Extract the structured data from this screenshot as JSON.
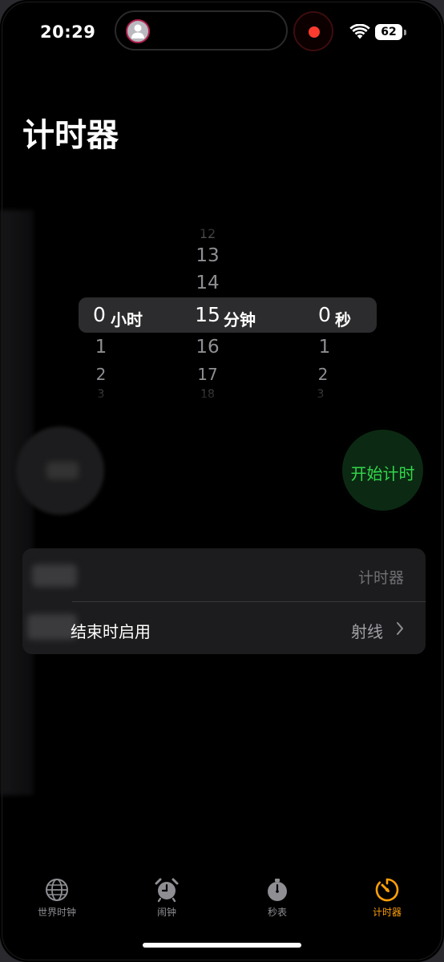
{
  "status_bar": {
    "time": "20:29",
    "battery": "62"
  },
  "page": {
    "title": "计时器"
  },
  "picker": {
    "hours": {
      "above": [
        "",
        ""
      ],
      "selected": "0",
      "unit": "小时",
      "below": [
        "1",
        "2",
        "3"
      ]
    },
    "minutes": {
      "above": [
        "12",
        "13",
        "14"
      ],
      "selected": "15",
      "unit": "分钟",
      "below": [
        "16",
        "17",
        "18"
      ]
    },
    "seconds": {
      "above": [
        "",
        ""
      ],
      "selected": "0",
      "unit": "秒",
      "below": [
        "1",
        "2",
        "3"
      ]
    }
  },
  "buttons": {
    "start": "开始计时"
  },
  "settings": {
    "label_row": {
      "value": "计时器"
    },
    "end_row": {
      "label": "结束时启用",
      "value": "射线"
    }
  },
  "tabbar": {
    "tabs": [
      {
        "label": "世界时钟",
        "icon": "globe-icon",
        "active": false
      },
      {
        "label": "闹钟",
        "icon": "alarm-clock-icon",
        "active": false
      },
      {
        "label": "秒表",
        "icon": "stopwatch-icon",
        "active": false
      },
      {
        "label": "计时器",
        "icon": "timer-icon",
        "active": true
      }
    ]
  },
  "colors": {
    "accent_active": "#ff9f0a",
    "start_green": "#32d74b",
    "recording_red": "#ff3b30"
  }
}
